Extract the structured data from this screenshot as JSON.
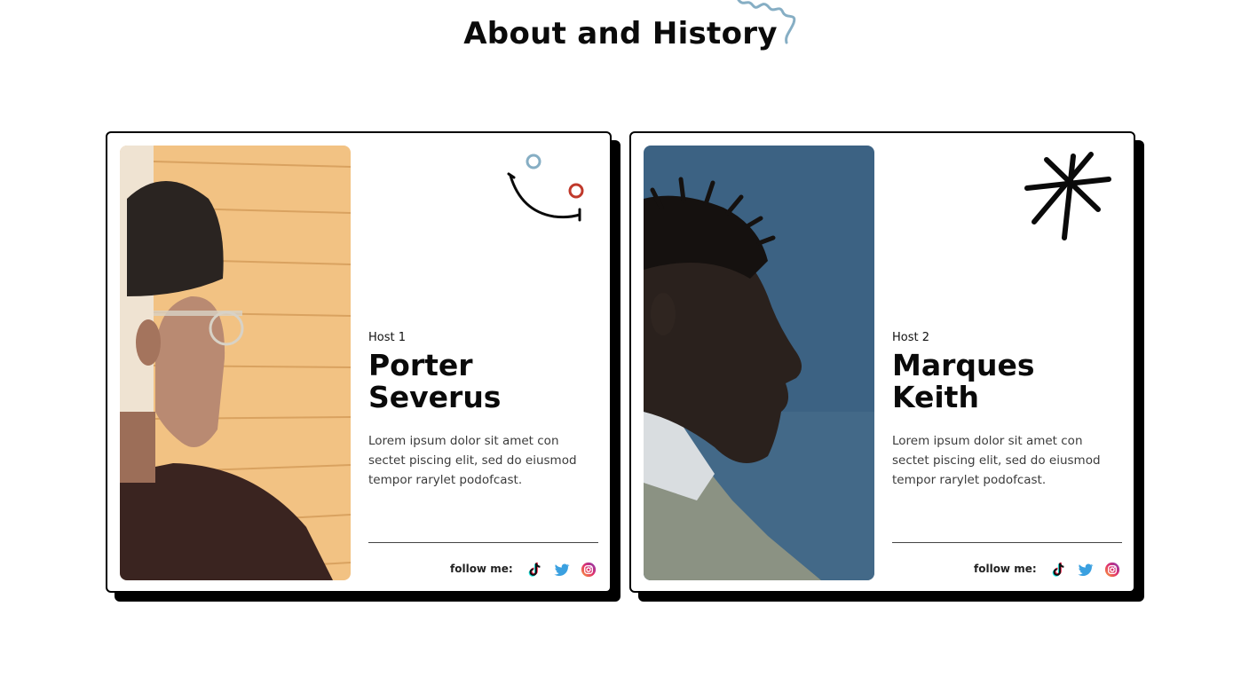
{
  "page": {
    "title": "About and History"
  },
  "hosts": [
    {
      "label": "Host 1",
      "name_line1": "Porter",
      "name_line2": "Severus",
      "description": "Lorem ipsum dolor sit amet con sectet piscing elit, sed do eiusmod tempor rarylet podofcast.",
      "follow_label": "follow me:",
      "socials": [
        "tiktok-icon",
        "twitter-icon",
        "instagram-icon"
      ],
      "photo_bg": "#f2c283"
    },
    {
      "label": "Host 2",
      "name_line1": "Marques",
      "name_line2": "Keith",
      "description": "Lorem ipsum dolor sit amet con sectet piscing elit, sed do eiusmod tempor rarylet podofcast.",
      "follow_label": "follow me:",
      "socials": [
        "tiktok-icon",
        "twitter-icon",
        "instagram-icon"
      ],
      "photo_bg": "#3c6283"
    }
  ],
  "colors": {
    "accent_blue": "#86aec4",
    "accent_red": "#c0392b",
    "twitter": "#3aa0e0",
    "instagram": "#d6257a"
  }
}
